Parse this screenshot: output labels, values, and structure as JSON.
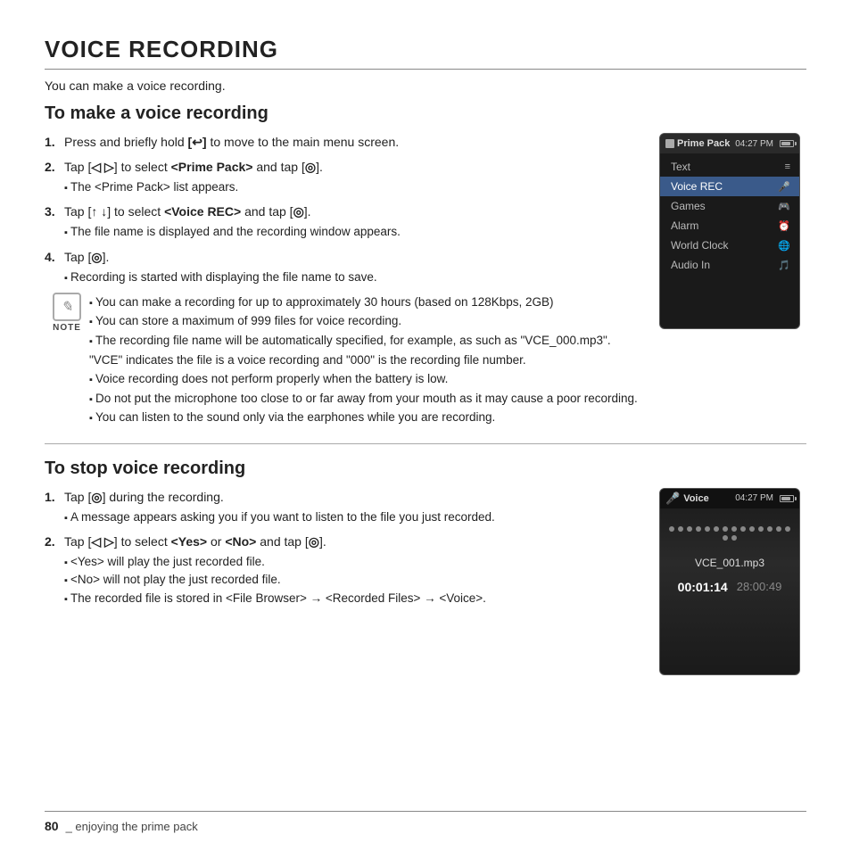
{
  "page": {
    "title": "VOICE RECORDING",
    "subtitle": "You can make a voice recording.",
    "section1": {
      "header": "To make a voice recording",
      "steps": [
        {
          "num": "1.",
          "text": "Press and briefly hold ",
          "bold": "[↩]",
          "text2": " to move to the main menu screen."
        },
        {
          "num": "2.",
          "text": "Tap [",
          "nav": "◁ ▷",
          "text2": "] to select ",
          "bold": "<Prime Pack>",
          "text3": " and tap [",
          "circle": "◎",
          "text4": "].",
          "sub": [
            "The <Prime Pack> list appears."
          ]
        },
        {
          "num": "3.",
          "text": "Tap [",
          "nav": "↑ ↓",
          "text2": "] to select ",
          "bold": "<Voice REC>",
          "text3": " and tap [",
          "circle": "◎",
          "text4": "].",
          "sub": [
            "The file name is displayed and the recording window appears."
          ]
        },
        {
          "num": "4.",
          "text": "Tap [",
          "circle": "◎",
          "text2": "].",
          "sub": [
            "Recording is started with displaying the file name to save."
          ]
        }
      ],
      "notes": [
        "You can make a recording for up to approximately 30 hours (based on 128Kbps, 2GB)",
        "You can store a maximum of 999 files for voice recording.",
        "The recording file name will be automatically specified, for example, as such as \"VCE_000.mp3\". \"VCE\" indicates the file is a voice recording and \"000\" is the recording file number.",
        "Voice recording does not perform properly when the battery is low.",
        "Do not put the microphone too close to or far away from your mouth as it may cause a poor recording.",
        "You can listen to the sound only via the earphones while you are recording."
      ]
    },
    "section2": {
      "header": "To stop voice recording",
      "steps": [
        {
          "num": "1.",
          "text": "Tap [",
          "circle": "◎",
          "text2": "] during the recording.",
          "sub": [
            "A message appears asking you if you want to listen to the file you just recorded."
          ]
        },
        {
          "num": "2.",
          "text": "Tap [",
          "nav": "◁ ▷",
          "text2": "] to select ",
          "bold1": "<Yes>",
          "text3": " or ",
          "bold2": "<No>",
          "text4": " and tap [",
          "circle": "◎",
          "text5": "].",
          "sub": [
            "<Yes> will play the just recorded file.",
            "<No> will not play the just recorded file.",
            "The recorded file is stored in <File Browser> → <Recorded Files> → <Voice>."
          ]
        }
      ]
    },
    "device1": {
      "topbar": {
        "icon": "▤",
        "title": "Prime Pack",
        "time": "04:27 PM"
      },
      "menu": [
        {
          "label": "Text",
          "icon": "≡",
          "selected": false
        },
        {
          "label": "Voice REC",
          "icon": "🎤",
          "selected": true
        },
        {
          "label": "Games",
          "icon": "🎮",
          "selected": false
        },
        {
          "label": "Alarm",
          "icon": "⏰",
          "selected": false
        },
        {
          "label": "World Clock",
          "icon": "🌐",
          "selected": false
        },
        {
          "label": "Audio In",
          "icon": "🎵",
          "selected": false
        }
      ]
    },
    "device2": {
      "topbar": {
        "icon": "🎤",
        "title": "Voice",
        "time": "04:27 PM"
      },
      "dots_count": 16,
      "filename": "VCE_001.mp3",
      "timer_main": "00:01:14",
      "timer_remaining": "28:00:49"
    },
    "footer": {
      "page": "80",
      "desc": "_ enjoying the prime pack"
    }
  }
}
